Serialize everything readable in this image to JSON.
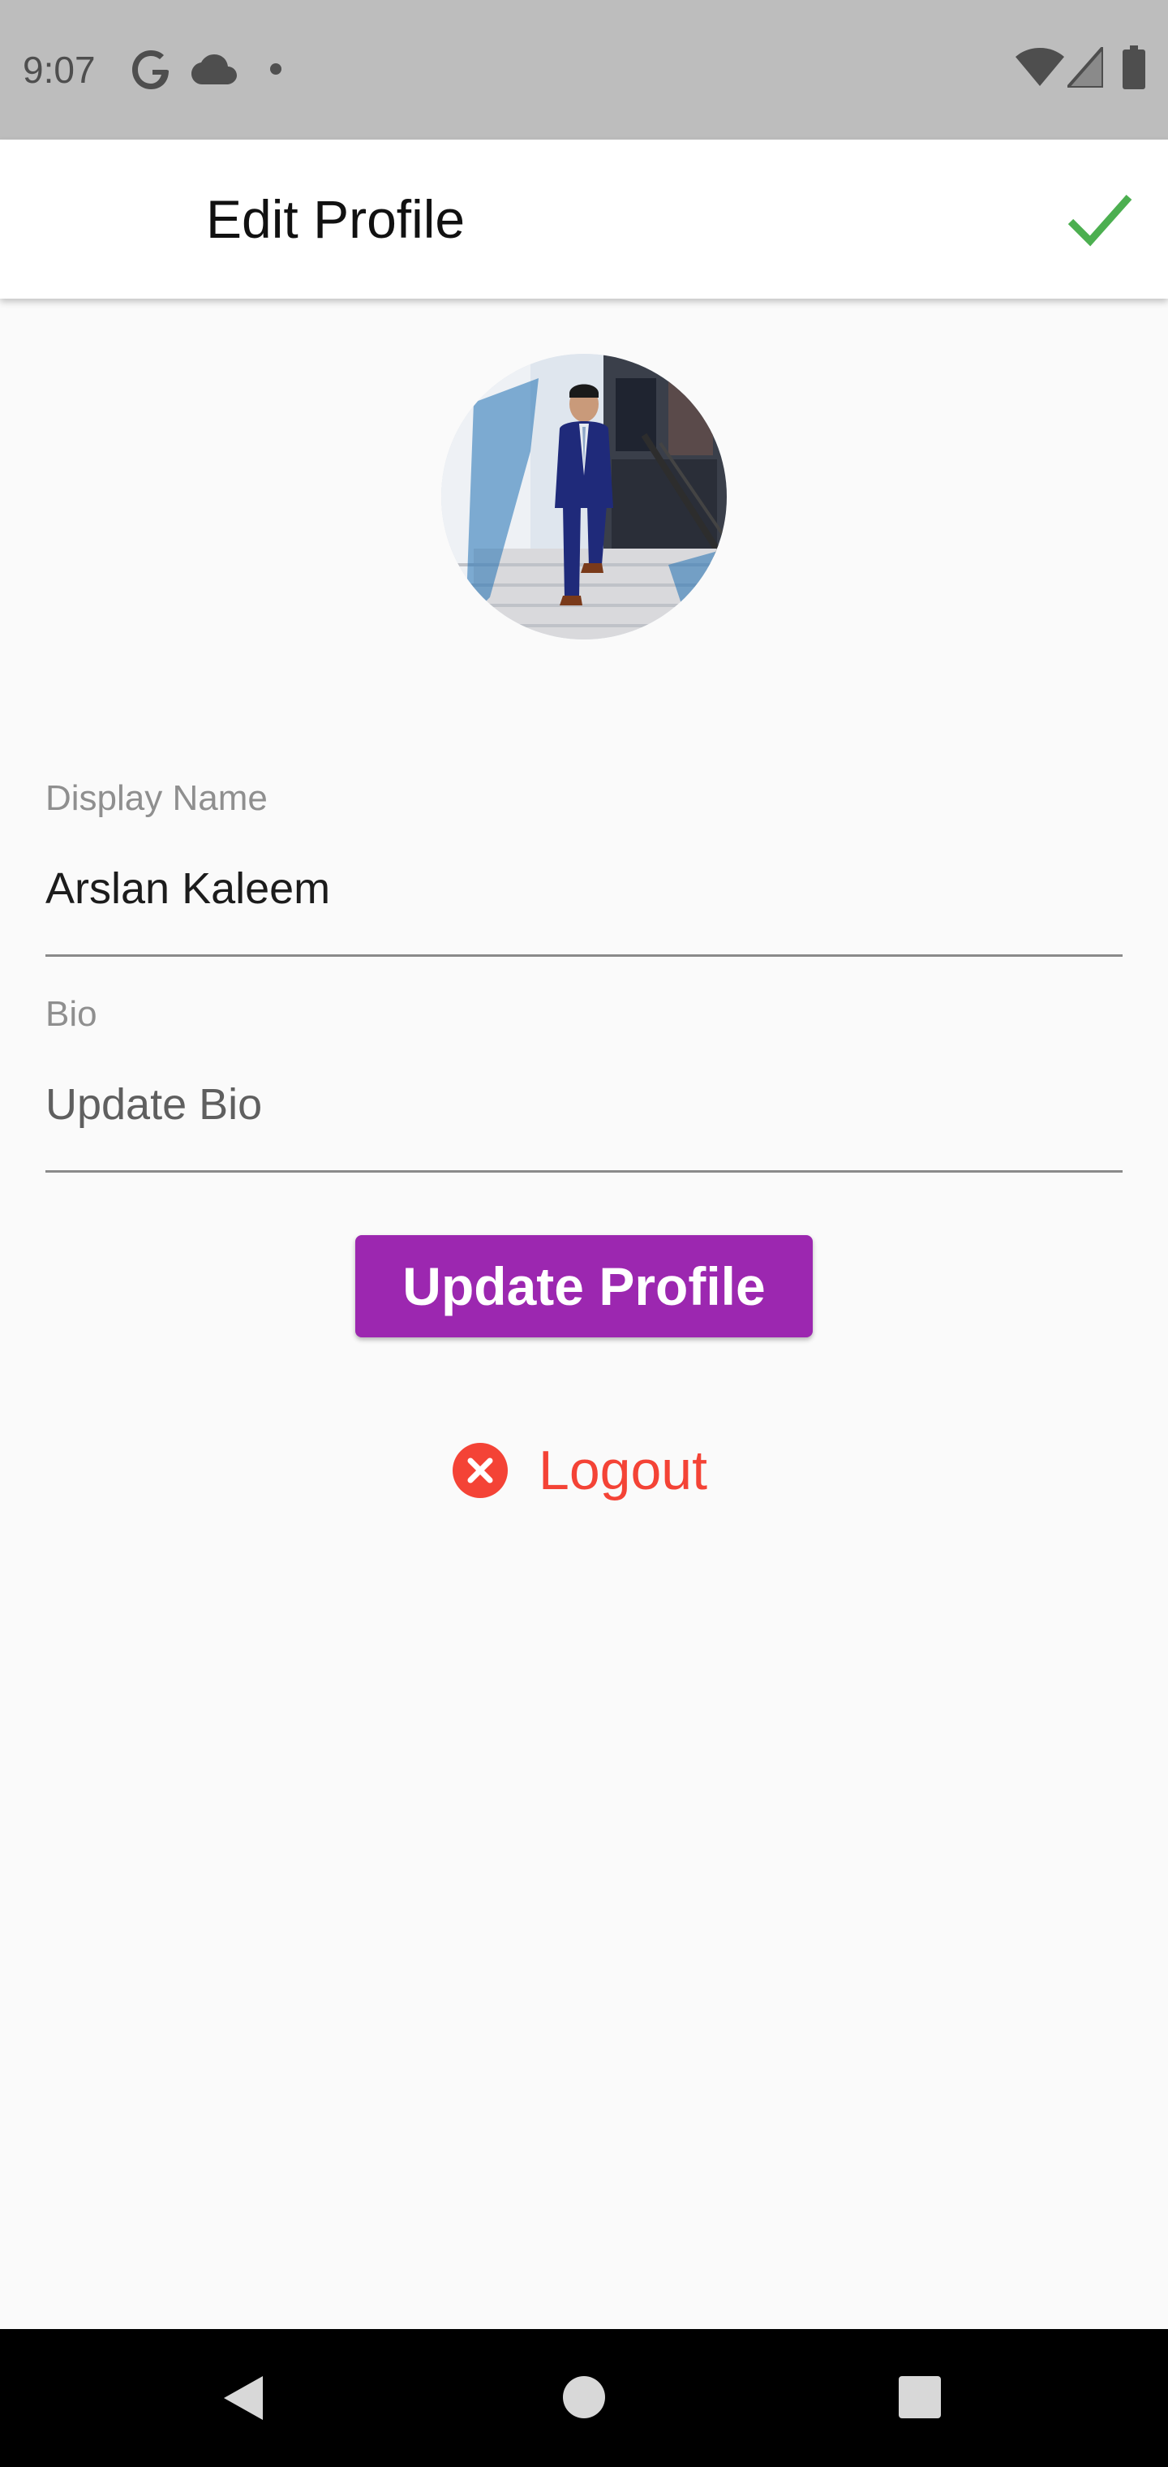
{
  "status_bar": {
    "time": "9:07",
    "icons": [
      "google-g-icon",
      "cloud-icon",
      "notification-dot-icon",
      "wifi-icon",
      "signal-icon",
      "battery-icon"
    ]
  },
  "app_bar": {
    "title": "Edit Profile",
    "action_icon": "check-icon",
    "action_color": "#4caf50"
  },
  "profile": {
    "avatar": "profile-photo"
  },
  "form": {
    "display_name": {
      "label": "Display Name",
      "value": "Arslan Kaleem"
    },
    "bio": {
      "label": "Bio",
      "placeholder": "Update Bio",
      "value": ""
    }
  },
  "actions": {
    "update_label": "Update Profile",
    "update_color": "#9c27b0",
    "logout_label": "Logout",
    "logout_icon": "cancel-icon",
    "logout_color": "#f44336"
  },
  "nav_bar": {
    "icons": [
      "back-icon",
      "home-icon",
      "recents-icon"
    ]
  }
}
